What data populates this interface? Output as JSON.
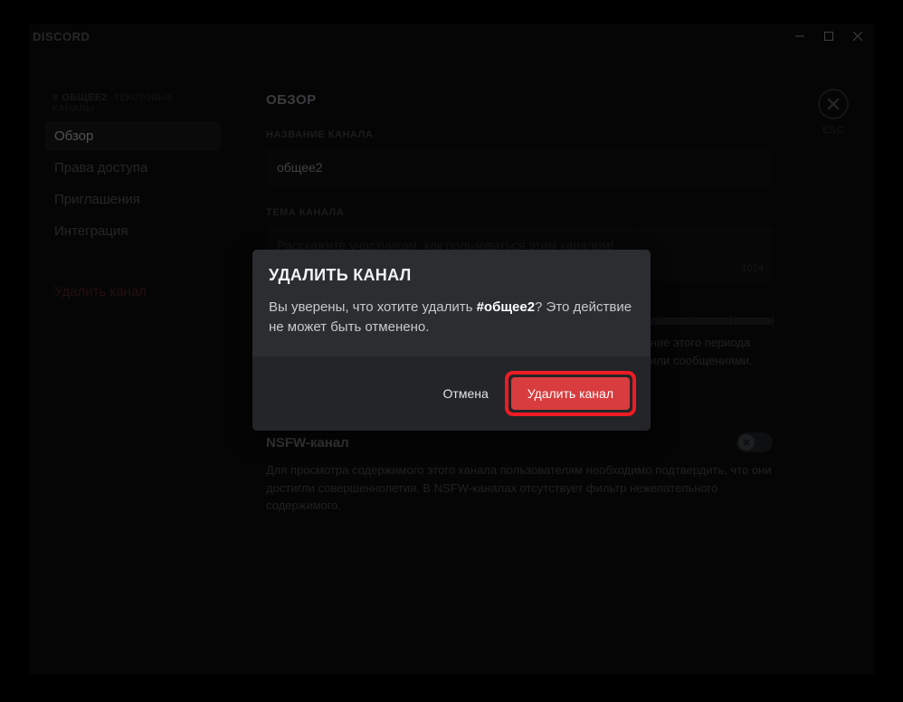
{
  "app": {
    "brand": "DISCORD"
  },
  "esc": {
    "label": "ESC"
  },
  "sidebar": {
    "heading_hash": "#",
    "heading_name": "ОБЩЕЕ2",
    "heading_suffix": "ТЕКСТОВЫЕ КАНАЛЫ",
    "items": [
      {
        "label": "Обзор"
      },
      {
        "label": "Права доступа"
      },
      {
        "label": "Приглашения"
      },
      {
        "label": "Интеграция"
      }
    ],
    "danger": {
      "label": "Удалить канал"
    }
  },
  "content": {
    "section_title": "ОБЗОР",
    "name_label": "НАЗВАНИЕ КАНАЛА",
    "name_value": "общее2",
    "topic_label": "ТЕМА КАНАЛА",
    "topic_placeholder": "Расскажите участникам, как пользоваться этим каналом!",
    "topic_count": "1024",
    "slowmode_desc": "Пользователи не смогут отправлять больше одного сообщения в течение этого периода времени, кроме случаев, когда у них есть права управления каналом или сообщениями.",
    "nsfw_title": "NSFW-канал",
    "nsfw_desc": "Для просмотра содержимого этого канала пользователям необходимо подтвердить, что они достигли совершеннолетия. В NSFW-каналах отсутствует фильтр нежелательного содержимого."
  },
  "modal": {
    "title": "УДАЛИТЬ КАНАЛ",
    "text_pre": "Вы уверены, что хотите удалить ",
    "text_channel": "#общее2",
    "text_post": "? Это действие не может быть отменено.",
    "cancel": "Отмена",
    "delete": "Удалить канал"
  }
}
